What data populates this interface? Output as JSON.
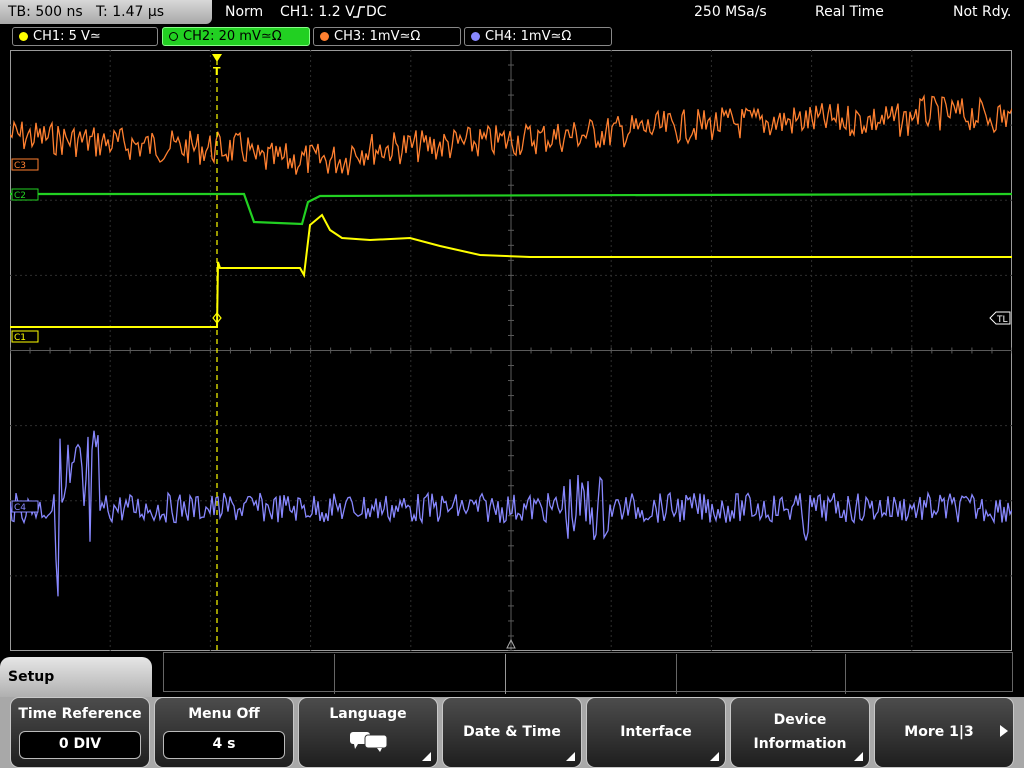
{
  "status": {
    "timebase": "TB: 500 ns",
    "trigger_time": "T: 1.47 µs",
    "mode": "Norm",
    "trigger_source": "CH1: 1.2 V",
    "trigger_coupling": "DC",
    "sample_rate": "250 MSa/s",
    "acq_mode": "Real Time",
    "run_state": "Not Rdy."
  },
  "channels": [
    {
      "label": "CH1: 5 V≃",
      "color": "#ffff00"
    },
    {
      "label": "CH2: 20 mV≃Ω",
      "color": "#22d022"
    },
    {
      "label": "CH3: 1mV≃Ω",
      "color": "#ff8030"
    },
    {
      "label": "CH4: 1mV≃Ω",
      "color": "#8888ff"
    }
  ],
  "trace_markers": {
    "c3": "C3",
    "c2": "C2",
    "c1": "C1",
    "c4": "C4",
    "trigger_level": "TL",
    "trigger_pos": "T"
  },
  "menu": {
    "title": "Setup",
    "keys": [
      {
        "label": "Time Reference",
        "value": "0 DIV"
      },
      {
        "label": "Menu Off",
        "value": "4 s"
      },
      {
        "label": "Language",
        "icon": "speech-bubbles-icon"
      },
      {
        "label": "Date & Time"
      },
      {
        "label": "Interface"
      },
      {
        "label": "Device",
        "label2": "Information"
      },
      {
        "label": "More 1|3"
      }
    ]
  }
}
